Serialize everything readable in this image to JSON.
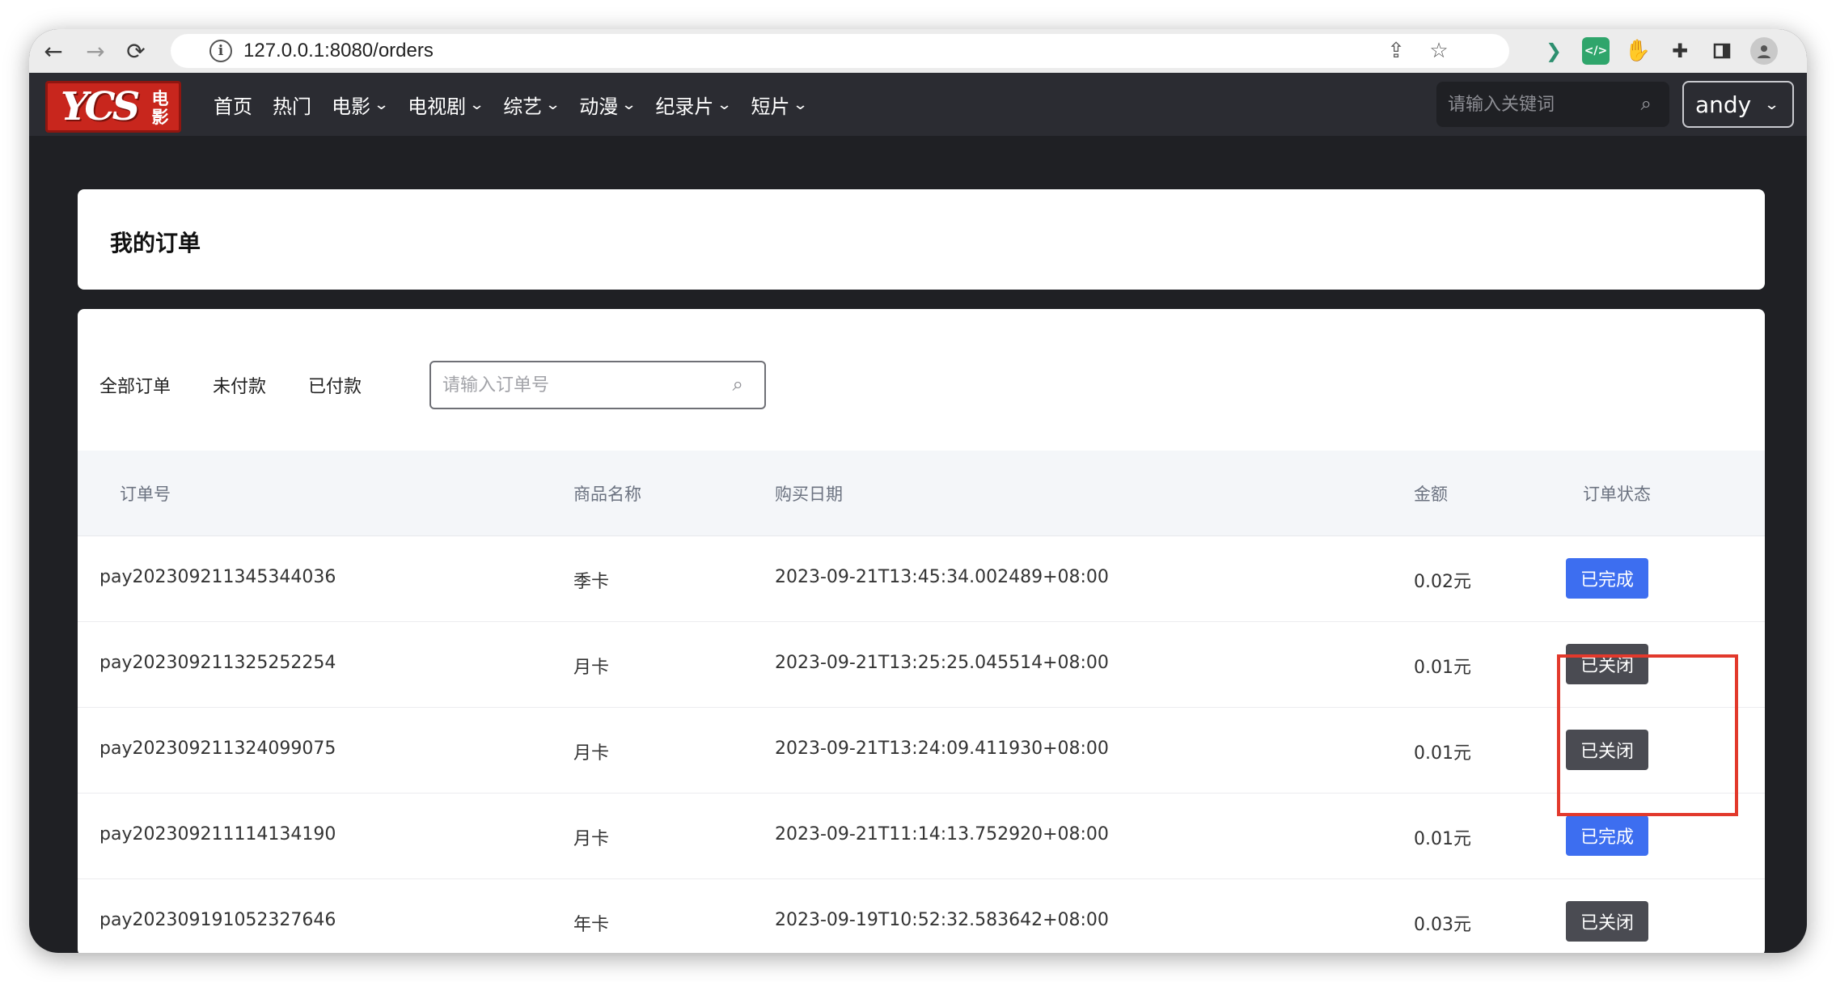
{
  "browser": {
    "url": "127.0.0.1:8080/orders",
    "back_icon": "←",
    "forward_icon": "→",
    "reload_icon": "⟳",
    "share_icon": "⇪",
    "star_icon": "☆"
  },
  "header": {
    "logo_mark": "YCS",
    "logo_sub": "电影",
    "menu": [
      {
        "label": "首页",
        "has_dropdown": false
      },
      {
        "label": "热门",
        "has_dropdown": false
      },
      {
        "label": "电影",
        "has_dropdown": true
      },
      {
        "label": "电视剧",
        "has_dropdown": true
      },
      {
        "label": "综艺",
        "has_dropdown": true
      },
      {
        "label": "动漫",
        "has_dropdown": true
      },
      {
        "label": "纪录片",
        "has_dropdown": true
      },
      {
        "label": "短片",
        "has_dropdown": true
      }
    ],
    "search_placeholder": "请输入关键词",
    "username": "andy"
  },
  "page": {
    "title": "我的订单",
    "filters": [
      "全部订单",
      "未付款",
      "已付款"
    ],
    "order_search_placeholder": "请输入订单号"
  },
  "table": {
    "columns": [
      "订单号",
      "商品名称",
      "购买日期",
      "金额",
      "订单状态"
    ],
    "rows": [
      {
        "order_id": "pay202309211345344036",
        "product": "季卡",
        "date": "2023-09-21T13:45:34.002489+08:00",
        "amount": "0.02元",
        "status": "已完成",
        "status_type": "completed"
      },
      {
        "order_id": "pay202309211325252254",
        "product": "月卡",
        "date": "2023-09-21T13:25:25.045514+08:00",
        "amount": "0.01元",
        "status": "已关闭",
        "status_type": "closed"
      },
      {
        "order_id": "pay202309211324099075",
        "product": "月卡",
        "date": "2023-09-21T13:24:09.411930+08:00",
        "amount": "0.01元",
        "status": "已关闭",
        "status_type": "closed"
      },
      {
        "order_id": "pay202309211114134190",
        "product": "月卡",
        "date": "2023-09-21T11:14:13.752920+08:00",
        "amount": "0.01元",
        "status": "已完成",
        "status_type": "completed"
      },
      {
        "order_id": "pay202309191052327646",
        "product": "年卡",
        "date": "2023-09-19T10:52:32.583642+08:00",
        "amount": "0.03元",
        "status": "已关闭",
        "status_type": "closed"
      }
    ]
  },
  "colors": {
    "completed": "#3d6ef0",
    "closed": "#4a4b52",
    "highlight": "#e2392c",
    "header_bg": "#2b2c32"
  }
}
